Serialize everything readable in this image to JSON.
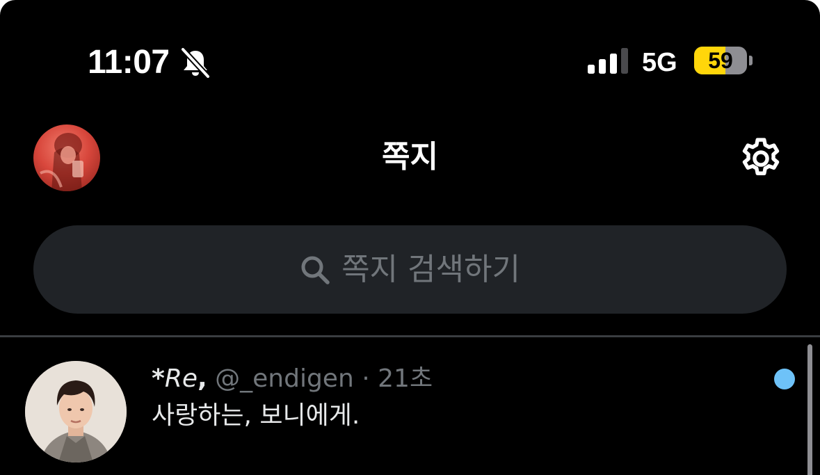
{
  "status_bar": {
    "time": "11:07",
    "network": "5G",
    "battery_percent": "59",
    "battery_level": 0.59,
    "icons": [
      "bell-slash-icon",
      "signal-bars-icon",
      "battery-icon"
    ]
  },
  "header": {
    "title": "쪽지",
    "icons": [
      "profile-avatar",
      "gear-icon"
    ]
  },
  "search": {
    "placeholder": "쪽지 검색하기",
    "icon": "search-icon"
  },
  "conversations": [
    {
      "name_prefix": "*",
      "name_italic": "Re",
      "name_suffix": ",",
      "handle": "@_endigen",
      "separator": "·",
      "time": "21초",
      "preview": "사랑하는, 보니에게.",
      "unread": true
    }
  ],
  "colors": {
    "background": "#000000",
    "search_bg": "#202327",
    "muted_text": "#71767b",
    "unread_dot": "#6ec2f8",
    "battery_fill": "#ffd60a"
  }
}
